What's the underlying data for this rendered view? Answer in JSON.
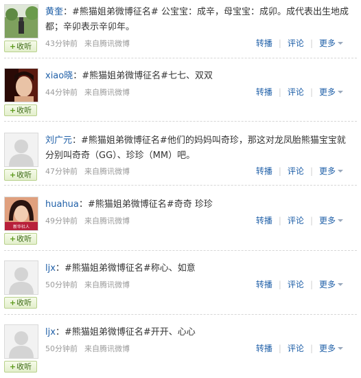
{
  "follow_label": "收听",
  "follow_plus": "+",
  "actions": {
    "repost": "转播",
    "comment": "评论",
    "more": "更多",
    "divider": "|"
  },
  "posts": [
    {
      "author": "黄奎",
      "separator": "：",
      "text": "#熊猫姐弟微博征名# 公宝宝：成辛，母宝宝：成卯。成代表出生地成都；辛卯表示辛卯年。",
      "time": "43分钟前",
      "source": "来自腾讯微博",
      "avatar_icon": "landscape-photo-icon"
    },
    {
      "author": "xiao晓",
      "separator": "：",
      "text": "#熊猫姐弟微博征名#七七、双双",
      "time": "44分钟前",
      "source": "来自腾讯微博",
      "avatar_icon": "portrait-photo-icon"
    },
    {
      "author": "刘广元",
      "separator": "：",
      "text": "#熊猫姐弟微博征名#他们的妈妈叫奇珍，那这对龙凤胎熊猫宝宝就分别叫奇奇（GG）、珍珍（MM）吧。",
      "time": "47分钟前",
      "source": "来自腾讯微博",
      "avatar_icon": "default-avatar-icon"
    },
    {
      "author": "huahua",
      "separator": "：",
      "text": "#熊猫姐弟微博征名#奇奇 珍珍",
      "time": "49分钟前",
      "source": "来自腾讯微博",
      "avatar_icon": "woman-photo-icon",
      "avatar_caption": "新华社人"
    },
    {
      "author": "ljx",
      "separator": "：",
      "text": "#熊猫姐弟微博征名#称心、如意",
      "time": "50分钟前",
      "source": "来自腾讯微博",
      "avatar_icon": "default-avatar-icon"
    },
    {
      "author": "ljx",
      "separator": "：",
      "text": "#熊猫姐弟微博征名#开开、心心",
      "time": "50分钟前",
      "source": "来自腾讯微博",
      "avatar_icon": "default-avatar-icon"
    }
  ]
}
